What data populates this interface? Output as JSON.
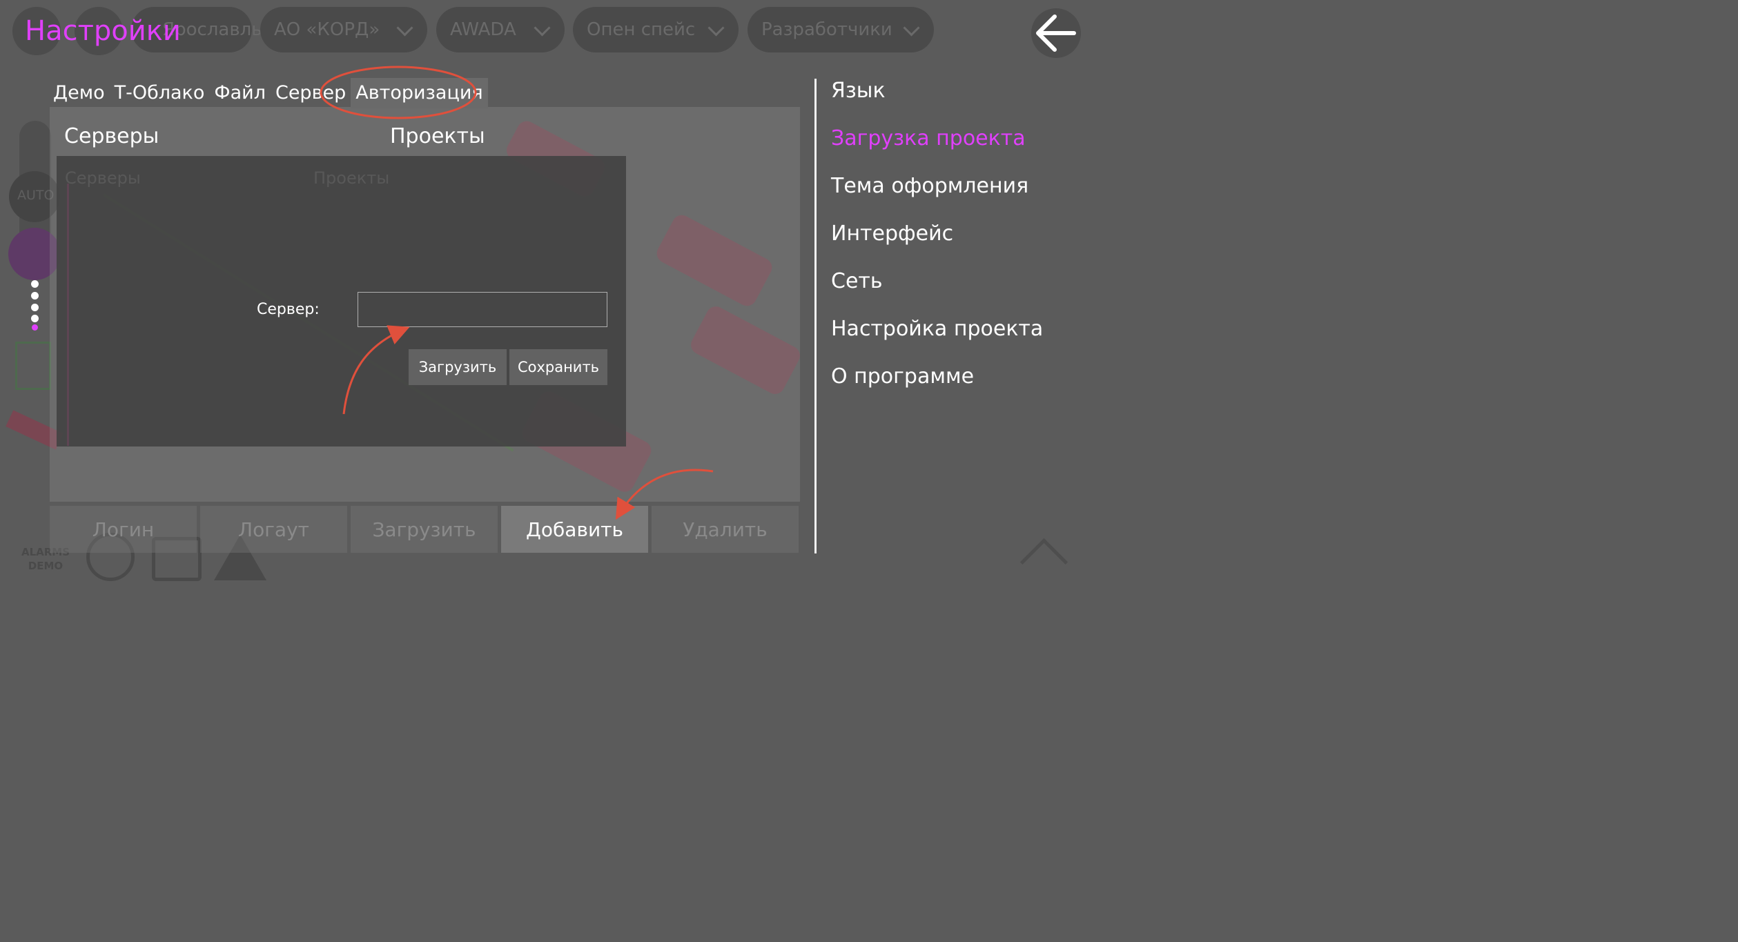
{
  "header": {
    "title": "Настройки",
    "back_icon": "arrow-left-icon"
  },
  "background_app": {
    "pills": [
      "Ярославль",
      "АО «КОРД»",
      "AWADA",
      "Опен спейс",
      "Разработчики"
    ],
    "auto_label": "AUTO",
    "alarms_label": "ALARMS DEMO"
  },
  "tabs": [
    {
      "label": "Демо"
    },
    {
      "label": "Т-Облако"
    },
    {
      "label": "Файл"
    },
    {
      "label": "Сервер"
    },
    {
      "label": "Авторизация",
      "active": true
    }
  ],
  "main": {
    "servers_title": "Серверы",
    "projects_title": "Проекты"
  },
  "dialog": {
    "ghost_servers": "Серверы",
    "ghost_projects": "Проекты",
    "server_label": "Сервер:",
    "server_value": "",
    "load_button": "Загрузить",
    "save_button": "Сохранить"
  },
  "bottom_buttons": [
    {
      "label": "Логин",
      "enabled": false
    },
    {
      "label": "Логаут",
      "enabled": false
    },
    {
      "label": "Загрузить",
      "enabled": false
    },
    {
      "label": "Добавить",
      "enabled": true
    },
    {
      "label": "Удалить",
      "enabled": false
    }
  ],
  "menu": [
    {
      "label": "Язык"
    },
    {
      "label": "Загрузка проекта",
      "active": true
    },
    {
      "label": "Тема оформления"
    },
    {
      "label": "Интерфейс"
    },
    {
      "label": "Сеть"
    },
    {
      "label": "Настройка проекта"
    },
    {
      "label": "О программе"
    }
  ],
  "colors": {
    "accent": "#e040fb",
    "annotation": "#e0503c"
  }
}
